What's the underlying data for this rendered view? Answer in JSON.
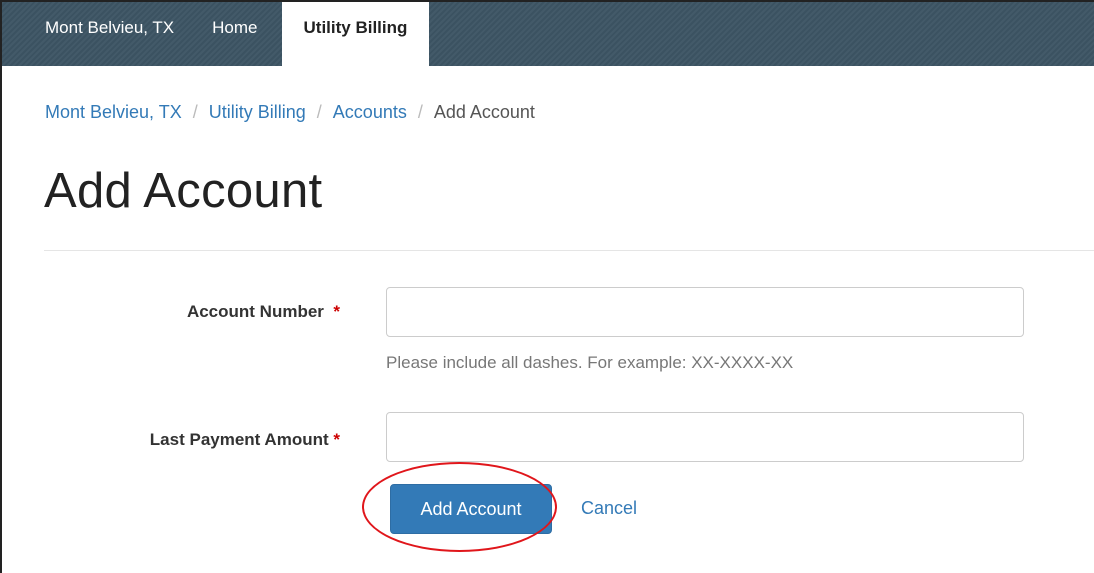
{
  "nav": {
    "brand": "Mont Belvieu, TX",
    "home": "Home",
    "active": "Utility Billing"
  },
  "breadcrumb": {
    "items": [
      "Mont Belvieu, TX",
      "Utility Billing",
      "Accounts"
    ],
    "current": "Add Account",
    "separator": "/"
  },
  "page": {
    "title": "Add Account"
  },
  "form": {
    "account_number_label": "Account Number",
    "account_number_value": "",
    "account_number_help": "Please include all dashes. For example: XX-XXXX-XX",
    "last_payment_label": "Last Payment Amount",
    "last_payment_value": "",
    "required_marker": "*",
    "submit_label": "Add Account",
    "cancel_label": "Cancel"
  },
  "colors": {
    "nav_bg": "#3d5564",
    "link": "#337ab7",
    "primary_button": "#337ab7",
    "highlight_ring": "#e0161b"
  }
}
